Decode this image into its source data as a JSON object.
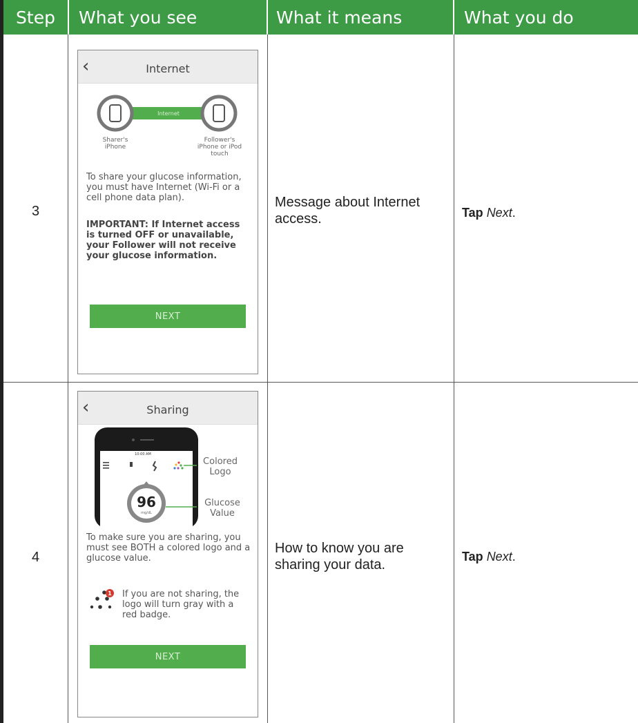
{
  "header": {
    "step": "Step",
    "what_you_see": "What you see",
    "what_it_means": "What it means",
    "what_you_do": "What you do"
  },
  "colors": {
    "header_bg": "#3d9a45",
    "button_green": "#52ad4d"
  },
  "rows": [
    {
      "step": "3",
      "screen": {
        "title": "Internet",
        "connection_label": "Internet",
        "sharer_label": "Sharer's iPhone",
        "follower_label": "Follower's iPhone or iPod touch",
        "body": "To share your glucose information, you must have Internet (Wi-Fi or a cell phone data plan).",
        "important": "IMPORTANT: If Internet access is turned OFF or unavailable, your Follower will not receive your glucose information.",
        "button": "NEXT"
      },
      "meaning": "Message about Internet access.",
      "action_verb": "Tap",
      "action_target": "Next",
      "action_end": "."
    },
    {
      "step": "4",
      "screen": {
        "title": "Sharing",
        "colored_logo_label": "Colored Logo",
        "glucose_value_label": "Glucose Value",
        "glucose_value": "96",
        "glucose_unit": "mg/dL",
        "status_time": "10:00 AM",
        "body": "To make sure you are sharing, you must see BOTH a colored logo and a glucose value.",
        "not_sharing": "If you are not sharing, the logo will turn gray with a red badge.",
        "badge_count": "1",
        "button": "NEXT"
      },
      "meaning": "How to know you are sharing your data.",
      "action_verb": "Tap",
      "action_target": "Next",
      "action_end": "."
    }
  ]
}
